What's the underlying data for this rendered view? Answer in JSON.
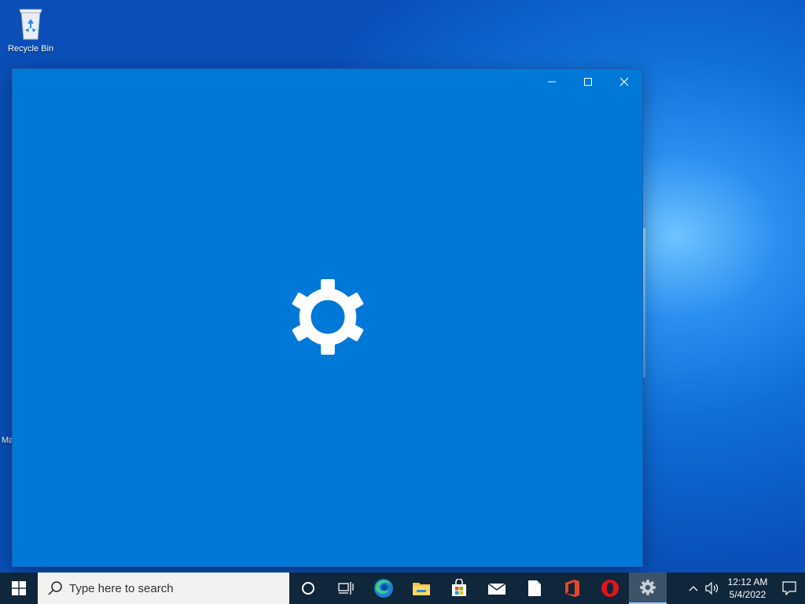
{
  "desktop": {
    "icons": [
      {
        "label": "Recycle Bin",
        "icon": "recycle-bin-icon"
      }
    ],
    "partial_label": "Ma"
  },
  "window": {
    "app": "Settings",
    "splash_icon": "gear-icon",
    "background": "#0078d7",
    "caption_buttons": [
      "minimize-icon",
      "maximize-icon",
      "close-icon"
    ]
  },
  "taskbar": {
    "start_icon": "windows-logo-icon",
    "search": {
      "placeholder": "Type here to search"
    },
    "pinned": [
      "cortana-icon",
      "task-view-icon",
      "edge-icon",
      "file-explorer-icon",
      "store-icon",
      "mail-icon",
      "document-icon",
      "office-icon",
      "opera-icon",
      "settings-icon"
    ],
    "active_app": "settings-icon",
    "tray": {
      "time": "12:12 AM",
      "date": "5/4/2022"
    }
  }
}
